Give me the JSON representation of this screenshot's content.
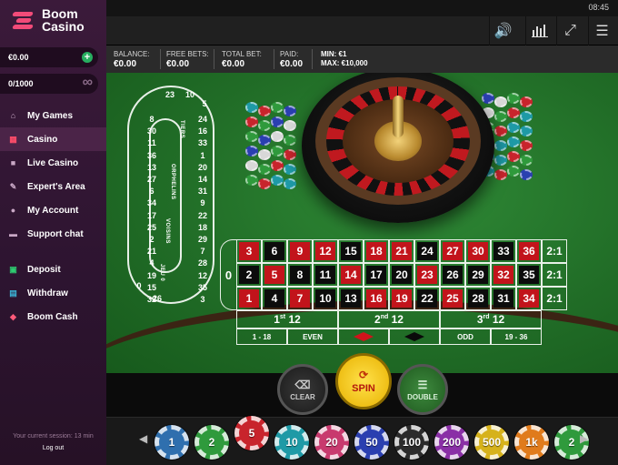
{
  "brand": {
    "line1": "Boom",
    "line2": "Casino"
  },
  "balances": {
    "cash": "€0.00",
    "bonus": "0/1000"
  },
  "nav": [
    {
      "label": "My Games",
      "icon": "home-icon"
    },
    {
      "label": "Casino",
      "icon": "grid-icon",
      "active": true
    },
    {
      "label": "Live Casino",
      "icon": "video-icon"
    },
    {
      "label": "Expert's Area",
      "icon": "pencil-icon"
    },
    {
      "label": "My Account",
      "icon": "user-icon"
    },
    {
      "label": "Support chat",
      "icon": "chat-icon"
    }
  ],
  "nav2": [
    {
      "label": "Deposit",
      "icon": "deposit-icon"
    },
    {
      "label": "Withdraw",
      "icon": "withdraw-icon"
    },
    {
      "label": "Boom Cash",
      "icon": "tag-icon"
    }
  ],
  "session": "Your current session: 13 min",
  "logout": "Log out",
  "clock": "08:45",
  "info": {
    "balance_label": "BALANCE:",
    "balance": "€0.00",
    "free_label": "FREE BETS:",
    "free": "€0.00",
    "total_label": "TOTAL BET:",
    "total": "€0.00",
    "paid_label": "PAID:",
    "paid": "€0.00",
    "min": "MIN: €1",
    "max": "MAX: €10,000"
  },
  "racetrack": {
    "top": [
      "23",
      "10",
      "5"
    ],
    "left": [
      "8",
      "30",
      "11",
      "36",
      "13",
      "27",
      "6",
      "34",
      "17",
      "25",
      "2",
      "21",
      "4",
      "19",
      "15",
      "32"
    ],
    "right": [
      "24",
      "16",
      "33",
      "1",
      "20",
      "14",
      "31",
      "9",
      "22",
      "18",
      "29",
      "7",
      "28",
      "12",
      "35",
      "3"
    ],
    "bottom": [
      "0",
      "26"
    ],
    "sections": {
      "tiers": "TIERS",
      "orphelins": "ORPHELINS",
      "voisins": "VOISINS",
      "jeu0": "JEU 0"
    }
  },
  "table": {
    "zero": "0",
    "rows": [
      [
        "3",
        "6",
        "9",
        "12",
        "15",
        "18",
        "21",
        "24",
        "27",
        "30",
        "33",
        "36"
      ],
      [
        "2",
        "5",
        "8",
        "11",
        "14",
        "17",
        "20",
        "23",
        "26",
        "29",
        "32",
        "35"
      ],
      [
        "1",
        "4",
        "7",
        "10",
        "13",
        "16",
        "19",
        "22",
        "25",
        "28",
        "31",
        "34"
      ]
    ],
    "red": [
      "1",
      "3",
      "5",
      "7",
      "9",
      "12",
      "14",
      "16",
      "18",
      "19",
      "21",
      "23",
      "25",
      "27",
      "30",
      "32",
      "34",
      "36"
    ],
    "columns": [
      "2:1",
      "2:1",
      "2:1"
    ],
    "dozens": [
      "1st 12",
      "2nd 12",
      "3rd 12"
    ],
    "outside": {
      "low": "1 - 18",
      "even": "EVEN",
      "odd": "ODD",
      "high": "19 - 36"
    }
  },
  "controls": {
    "clear": "CLEAR",
    "spin": "SPIN",
    "double": "DOUBLE"
  },
  "chips": [
    {
      "value": "1",
      "color": "#2f6fae"
    },
    {
      "value": "2",
      "color": "#2f9a3c"
    },
    {
      "value": "5",
      "color": "#c8242c"
    },
    {
      "value": "10",
      "color": "#1e9aa6"
    },
    {
      "value": "20",
      "color": "#c83a6e"
    },
    {
      "value": "50",
      "color": "#2a3fb0"
    },
    {
      "value": "100",
      "color": "#2b2b2b"
    },
    {
      "value": "200",
      "color": "#8a2fa6"
    },
    {
      "value": "500",
      "color": "#d6b21b"
    },
    {
      "value": "1k",
      "color": "#e07b1c"
    },
    {
      "value": "2",
      "color": "#2f9a3c"
    }
  ]
}
